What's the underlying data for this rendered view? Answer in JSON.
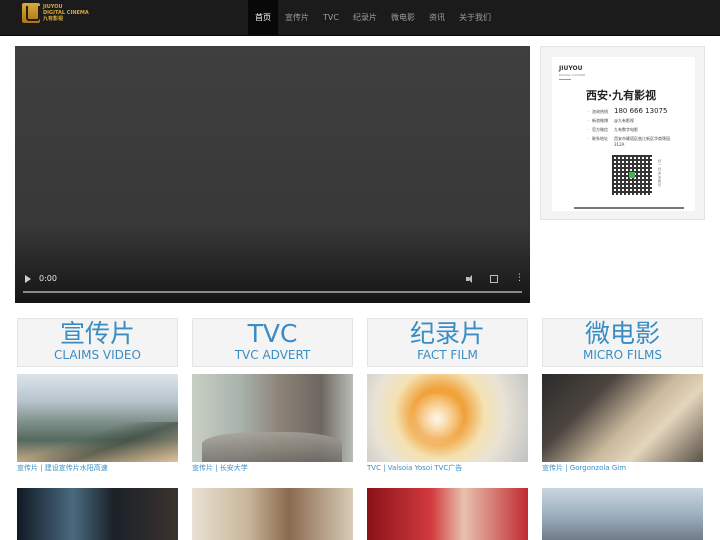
{
  "brand": {
    "logo_line1": "JIUYOU",
    "logo_line2": "DIGITAL CINEMA",
    "logo_line3": "九有影视"
  },
  "nav": {
    "items": [
      {
        "label": "首页",
        "active": true
      },
      {
        "label": "宣传片",
        "active": false
      },
      {
        "label": "TVC",
        "active": false
      },
      {
        "label": "纪录片",
        "active": false
      },
      {
        "label": "微电影",
        "active": false
      },
      {
        "label": "资讯",
        "active": false
      },
      {
        "label": "关于我们",
        "active": false
      }
    ]
  },
  "video": {
    "time": "0:00",
    "controls": [
      "play-icon",
      "volume-icon",
      "fullscreen-icon",
      "more-icon"
    ]
  },
  "card": {
    "brand": "JIUYOU",
    "brand_sub": "DIGITAL CULTURE",
    "title": "西安·九有影视",
    "rows": [
      {
        "key": "咨询热线",
        "value": "180 666 13075"
      },
      {
        "key": "新浪微博",
        "value": "@九有影视"
      },
      {
        "key": "官方微信",
        "value": "九有数字电影"
      },
      {
        "key": "联系地址",
        "value": "西安市雁塔区曲江新区华商锦园312A"
      }
    ],
    "qr_side": "扫一扫关注我们"
  },
  "categories": [
    {
      "cn": "宣传片",
      "en": "CLAIMS VIDEO"
    },
    {
      "cn": "TVC",
      "en": "TVC ADVERT"
    },
    {
      "cn": "纪录片",
      "en": "FACT FILM"
    },
    {
      "cn": "微电影",
      "en": "MICRO FILMS"
    }
  ],
  "videos_row1": [
    {
      "caption": "宣传片 | 建设宣传片水阳高速"
    },
    {
      "caption": "宣传片 | 长安大学"
    },
    {
      "caption": "TVC | Valsoia Yosoi TVC广告"
    },
    {
      "caption": "宣传片 | Gorgonzola Gim"
    }
  ],
  "colors": {
    "nav_bg": "#1b1b1b",
    "accent": "#3a8dc4",
    "panel_bg": "#f4f4f4"
  }
}
